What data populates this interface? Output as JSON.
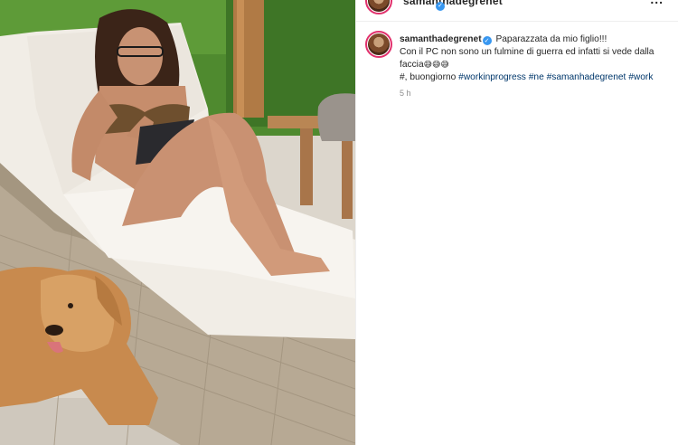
{
  "header": {
    "username": "samanthadegrenet",
    "more_label": "..."
  },
  "post": {
    "username": "samanthadegrenet",
    "verified_mark": "✓",
    "line1": "Paparazzata da mio figlio!!!",
    "line2": "Con il PC non sono un fulmine di guerra ed infatti si vede dalla",
    "line3_text": "faccia",
    "line3_emojis": "😅😅😅",
    "line4_prefix": "#, buongiorno",
    "hashtags": [
      "#workinprogress",
      "#ne",
      "#samanhadegrenet",
      "#work"
    ],
    "time": "5 h"
  },
  "icons": {
    "avatar": "profile-avatar",
    "verified": "verified-badge-icon",
    "more": "more-options-icon"
  },
  "colors": {
    "link": "#00376b",
    "verified": "#3897f0",
    "ring": "#e1306c",
    "muted": "#8e8e8e"
  }
}
